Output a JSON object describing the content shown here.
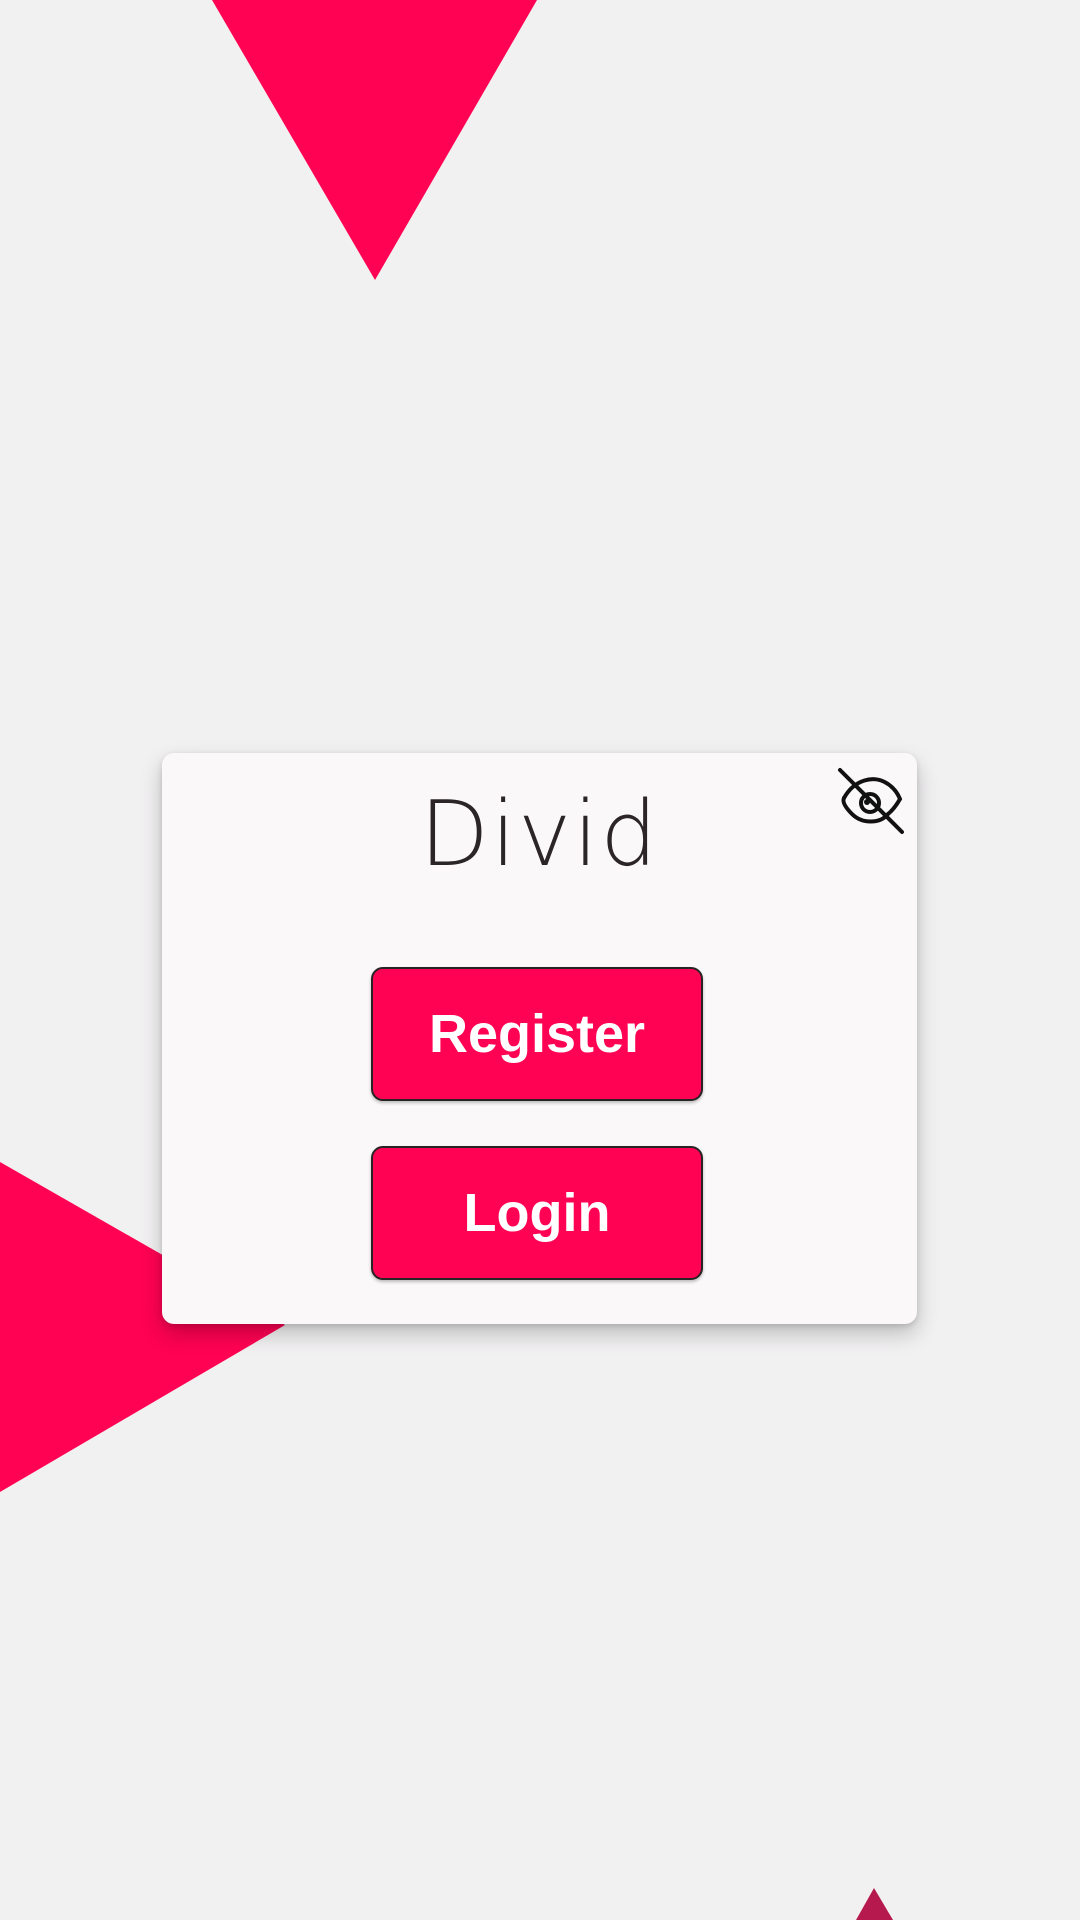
{
  "app": {
    "title": "Divid"
  },
  "buttons": {
    "register_label": "Register",
    "login_label": "Login"
  },
  "icons": {
    "visibility_toggle": "eye-off-icon"
  },
  "colors": {
    "accent": "#ff0253",
    "background": "#f2f1f2",
    "card": "#faf8f9",
    "text": "#2b2527",
    "button_text": "#ffffff"
  }
}
